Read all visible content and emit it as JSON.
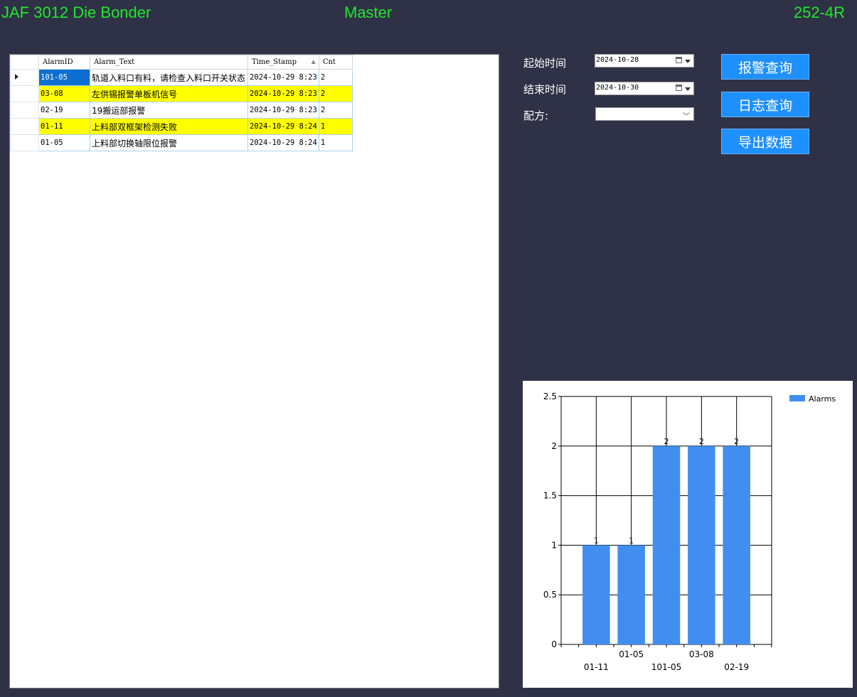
{
  "header": {
    "title": "JAF 3012 Die Bonder",
    "mode": "Master",
    "station": "252-4R"
  },
  "grid": {
    "columns": [
      "AlarmID",
      "Alarm_Text",
      "Time_Stamp",
      "Cnt"
    ],
    "rows": [
      {
        "id": "101-05",
        "text": "轨道入料口有料，请检查入料口开关状态",
        "time": "2024-10-29 8:23",
        "cnt": "2",
        "highlight": false,
        "current": true
      },
      {
        "id": "03-08",
        "text": "左供锡报警单板机信号",
        "time": "2024-10-29 8:23",
        "cnt": "2",
        "highlight": true,
        "current": false
      },
      {
        "id": "02-19",
        "text": "19搬运部报警",
        "time": "2024-10-29 8:23",
        "cnt": "2",
        "highlight": false,
        "current": false
      },
      {
        "id": "01-11",
        "text": "上料部双框架检测失败",
        "time": "2024-10-29 8:24",
        "cnt": "1",
        "highlight": true,
        "current": false
      },
      {
        "id": "01-05",
        "text": "上料部切换轴限位报警",
        "time": "2024-10-29 8:24",
        "cnt": "1",
        "highlight": false,
        "current": false
      }
    ]
  },
  "filter": {
    "start_label": "起始时间",
    "start_value": "2024-10-28",
    "end_label": "结束时间",
    "end_value": "2024-10-30",
    "recipe_label": "配方:",
    "recipe_value": ""
  },
  "buttons": {
    "alarm_query": "报警查询",
    "log_query": "日志查询",
    "export": "导出数据"
  },
  "colors": {
    "background": "#2f3247",
    "header_text": "#22e62c",
    "button": "#1e90ff",
    "highlight_row": "#ffff00",
    "selected_cell": "#0d6fd1",
    "bar": "#418ef0"
  },
  "chart_data": {
    "type": "bar",
    "categories": [
      "01-11",
      "01-05",
      "101-05",
      "03-08",
      "02-19"
    ],
    "series": [
      {
        "name": "Alarms",
        "values": [
          1,
          1,
          2,
          2,
          2
        ]
      }
    ],
    "ylim": [
      0,
      2.5
    ],
    "yticks": [
      0,
      0.5,
      1,
      1.5,
      2,
      2.5
    ],
    "ytick_labels": [
      "0",
      "0.5",
      "1",
      "1.5",
      "2",
      "2.5"
    ],
    "grid": true,
    "legend": "top-right",
    "title": "",
    "xlabel": "",
    "ylabel": ""
  }
}
